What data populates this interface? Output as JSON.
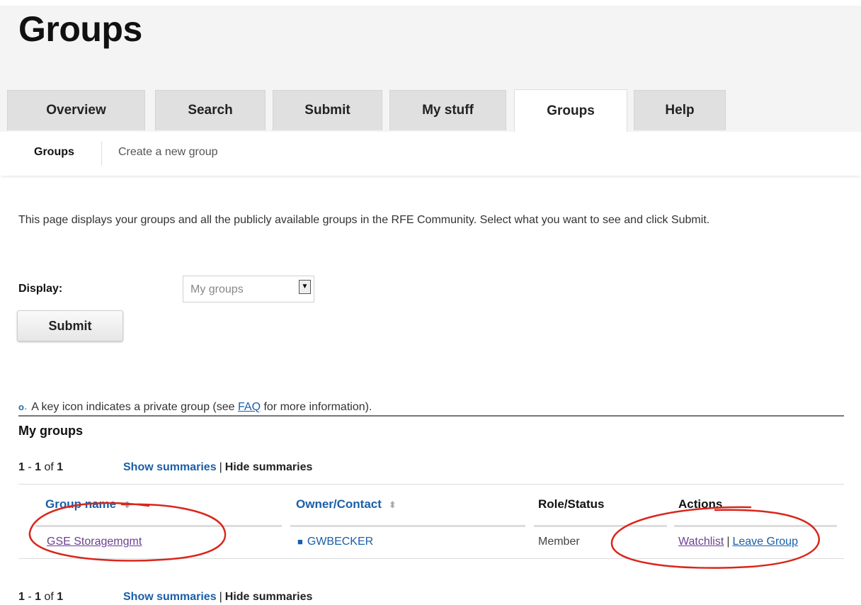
{
  "page": {
    "title": "Groups"
  },
  "tabs": [
    {
      "label": "Overview"
    },
    {
      "label": "Search"
    },
    {
      "label": "Submit"
    },
    {
      "label": "My stuff"
    },
    {
      "label": "Groups"
    },
    {
      "label": "Help"
    }
  ],
  "subnav": {
    "current": "Groups",
    "create_link": "Create a new group"
  },
  "intro": "This page displays your groups and all the publicly available groups in the RFE Community. Select what you want to see and click Submit.",
  "display": {
    "label": "Display:",
    "selected": "My groups"
  },
  "submit_label": "Submit",
  "key_note": {
    "prefix": "A key icon indicates a private group (see ",
    "faq": "FAQ",
    "suffix": " for more information)."
  },
  "section_title": "My groups",
  "pager": {
    "start": "1",
    "dash": " - ",
    "end": "1",
    "of": " of ",
    "total": "1",
    "show_summaries": "Show summaries",
    "separator": "|",
    "hide_summaries": "Hide summaries"
  },
  "table": {
    "headers": {
      "group_name": "Group name",
      "owner": "Owner/Contact",
      "role": "Role/Status",
      "actions": "Actions"
    },
    "rows": [
      {
        "group_name": "GSE Storagemgmt",
        "owner": "GWBECKER",
        "role": "Member",
        "watchlist": "Watchlist",
        "separator": "|",
        "leave": "Leave Group"
      }
    ]
  },
  "icons": {
    "key": "key-icon",
    "owner": "contact-card-icon",
    "sort": "sort-arrows-icon",
    "dropdown": "chevron-down-icon"
  },
  "colors": {
    "link": "#1a5fa8",
    "visited_link": "#6b3f8f",
    "annotation": "#d9261c"
  }
}
